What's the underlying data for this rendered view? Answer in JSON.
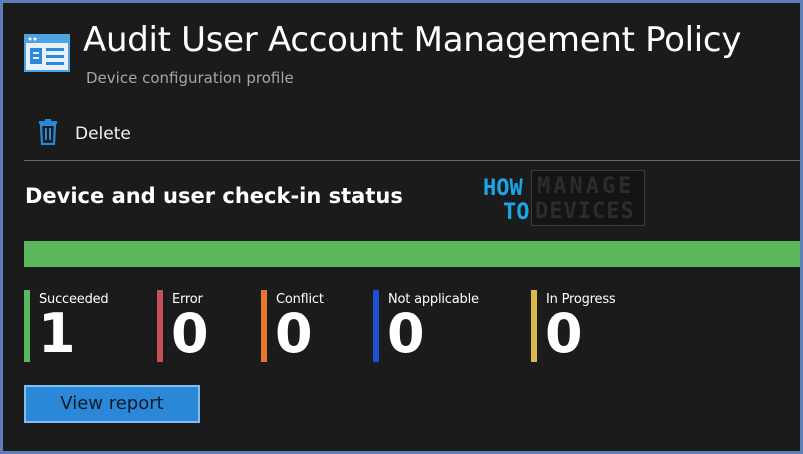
{
  "header": {
    "title": "Audit User Account Management Policy",
    "subtitle": "Device configuration profile"
  },
  "toolbar": {
    "delete_label": "Delete",
    "delete_icon": "trash-icon"
  },
  "section": {
    "title": "Device and user check-in status",
    "progress": {
      "succeeded_fraction": 1.0,
      "fill_color": "#5cb85c",
      "track_color": "#3a3a3a"
    },
    "tiles": [
      {
        "label": "Succeeded",
        "value": "1",
        "color": "#5cb85c"
      },
      {
        "label": "Error",
        "value": "0",
        "color": "#c8505a"
      },
      {
        "label": "Conflict",
        "value": "0",
        "color": "#e8772e"
      },
      {
        "label": "Not applicable",
        "value": "0",
        "color": "#1f4fd1"
      },
      {
        "label": "In Progress",
        "value": "0",
        "color": "#d8b94a"
      }
    ],
    "view_report_label": "View report"
  },
  "watermark": {
    "line1": "HOW",
    "line2": "TO",
    "box_line1": "MANAGE",
    "box_line2": "DEVICES"
  },
  "colors": {
    "background": "#1b1b1b",
    "frame_border": "#5d7fb8",
    "accent": "#2b88d8",
    "watermark_blue": "#1aa7e8"
  }
}
